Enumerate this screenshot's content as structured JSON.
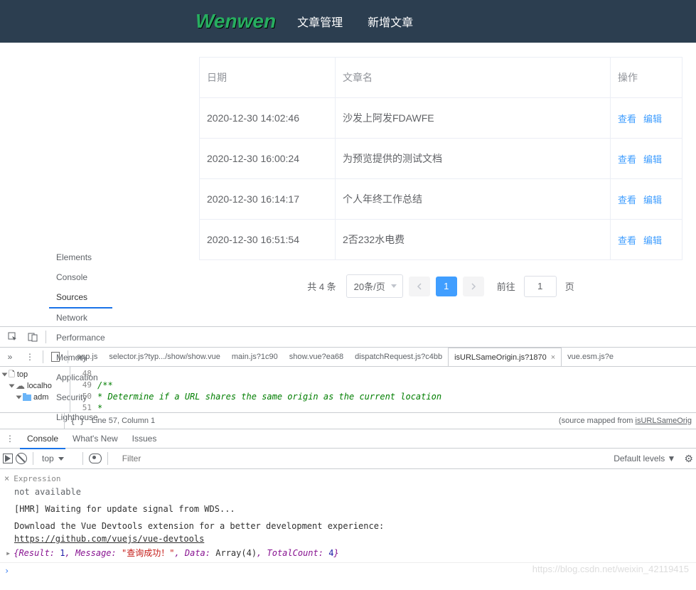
{
  "nav": {
    "brand": "Wenwen",
    "links": [
      "文章管理",
      "新增文章"
    ]
  },
  "table": {
    "headers": [
      "日期",
      "文章名",
      "操作"
    ],
    "rows": [
      {
        "date": "2020-12-30 14:02:46",
        "name": "沙发上阿发FDAWFE"
      },
      {
        "date": "2020-12-30 16:00:24",
        "name": "为预览提供的测试文档"
      },
      {
        "date": "2020-12-30 16:14:17",
        "name": "个人年终工作总结"
      },
      {
        "date": "2020-12-30 16:51:54",
        "name": "2否232水电费"
      }
    ],
    "ops": {
      "view": "查看",
      "edit": "编辑"
    }
  },
  "pager": {
    "total": "共 4 条",
    "size": "20条/页",
    "current": "1",
    "goto_label": "前往",
    "goto_suffix": "页",
    "goto_value": "1"
  },
  "devtools": {
    "mainTabs": [
      "Elements",
      "Console",
      "Sources",
      "Network",
      "Performance",
      "Memory",
      "Application",
      "Security",
      "Lighthouse"
    ],
    "activeMainTab": "Sources",
    "fileTabs": [
      "app.js",
      "selector.js?typ.../show/show.vue",
      "main.js?1c90",
      "show.vue?ea68",
      "dispatchRequest.js?c4bb",
      "isURLSameOrigin.js?1870",
      "vue.esm.js?e"
    ],
    "activeFileTab": "isURLSameOrigin.js?1870",
    "tree": {
      "root": "top",
      "host": "localho",
      "folder": "adm"
    },
    "code": {
      "start": 48,
      "lines": [
        "",
        "/**",
        " * Determine if a URL shares the same origin as the current location",
        " *"
      ]
    },
    "cursor": "Line 57, Column 1",
    "sourceMapped": "(source mapped from ",
    "sourceMappedFile": "isURLSameOrig",
    "drawerTabs": [
      "Console",
      "What's New",
      "Issues"
    ],
    "activeDrawerTab": "Console",
    "context": "top",
    "filterPlaceholder": "Filter",
    "levels": "Default levels ▼",
    "expression": {
      "label": "Expression",
      "value": "not available"
    },
    "logs": {
      "hmr": "[HMR] Waiting for update signal from WDS...",
      "vue1": "Download the Vue Devtools extension for a better development experience:",
      "vue2": "https://github.com/vuejs/vue-devtools",
      "result_prefix": "{Result:",
      "result_val": "1",
      "msg_key": ", Message:",
      "msg_val": "\"查询成功！\"",
      "data_key": ", Data:",
      "data_val": "Array(4)",
      "tc_key": ", TotalCount:",
      "tc_val": "4",
      "suffix": "}"
    },
    "watermark": "https://blog.csdn.net/weixin_42119415"
  }
}
